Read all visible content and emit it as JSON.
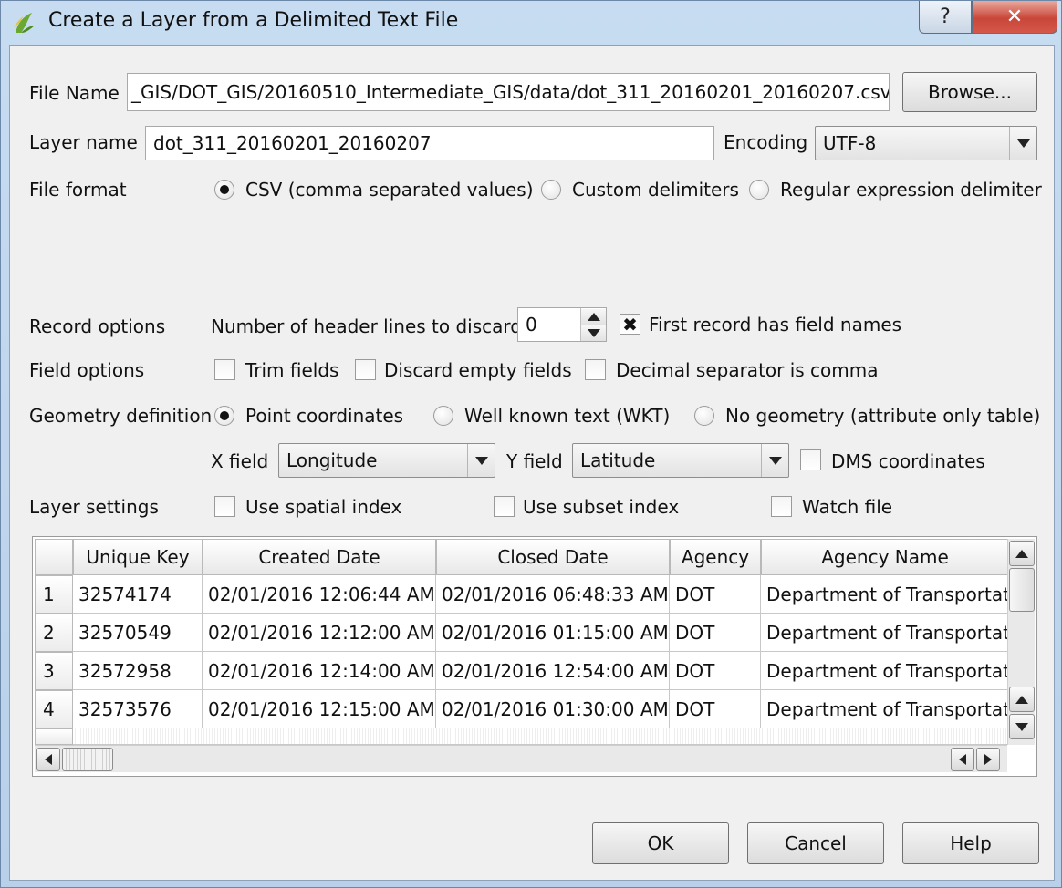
{
  "window": {
    "title": "Create a Layer from a Delimited Text File",
    "help_glyph": "?",
    "close_glyph": "✕"
  },
  "file": {
    "label": "File Name",
    "value": "_GIS/DOT_GIS/20160510_Intermediate_GIS/data/dot_311_20160201_20160207.csv",
    "browse_label": "Browse..."
  },
  "layer": {
    "label": "Layer name",
    "value": "dot_311_20160201_20160207",
    "encoding_label": "Encoding",
    "encoding_value": "UTF-8"
  },
  "file_format": {
    "label": "File format",
    "options": [
      {
        "label": "CSV (comma separated values)",
        "checked": true
      },
      {
        "label": "Custom delimiters",
        "checked": false
      },
      {
        "label": "Regular expression delimiter",
        "checked": false
      }
    ]
  },
  "record_options": {
    "label": "Record options",
    "header_lines_label": "Number of header lines to discard",
    "header_lines_value": "0",
    "first_record_label": "First record has field names",
    "first_record_checked": true
  },
  "field_options": {
    "label": "Field options",
    "trim_label": "Trim fields",
    "discard_label": "Discard empty fields",
    "decimal_label": "Decimal separator is comma"
  },
  "geometry": {
    "label": "Geometry definition",
    "options": [
      {
        "label": "Point coordinates",
        "checked": true
      },
      {
        "label": "Well known text (WKT)",
        "checked": false
      },
      {
        "label": "No geometry (attribute only table)",
        "checked": false
      }
    ],
    "x_label": "X field",
    "x_value": "Longitude",
    "y_label": "Y field",
    "y_value": "Latitude",
    "dms_label": "DMS coordinates"
  },
  "layer_settings": {
    "label": "Layer settings",
    "spatial_label": "Use spatial index",
    "subset_label": "Use subset index",
    "watch_label": "Watch file"
  },
  "table": {
    "columns": [
      "Unique Key",
      "Created Date",
      "Closed Date",
      "Agency",
      "Agency Name"
    ],
    "rows": [
      {
        "num": "1",
        "cells": [
          "32574174",
          "02/01/2016 12:06:44 AM",
          "02/01/2016 06:48:33 AM",
          "DOT",
          "Department of Transportati"
        ]
      },
      {
        "num": "2",
        "cells": [
          "32570549",
          "02/01/2016 12:12:00 AM",
          "02/01/2016 01:15:00 AM",
          "DOT",
          "Department of Transportati"
        ]
      },
      {
        "num": "3",
        "cells": [
          "32572958",
          "02/01/2016 12:14:00 AM",
          "02/01/2016 12:54:00 AM",
          "DOT",
          "Department of Transportati"
        ]
      },
      {
        "num": "4",
        "cells": [
          "32573576",
          "02/01/2016 12:15:00 AM",
          "02/01/2016 01:30:00 AM",
          "DOT",
          "Department of Transportati"
        ]
      }
    ]
  },
  "buttons": {
    "ok": "OK",
    "cancel": "Cancel",
    "help": "Help"
  }
}
